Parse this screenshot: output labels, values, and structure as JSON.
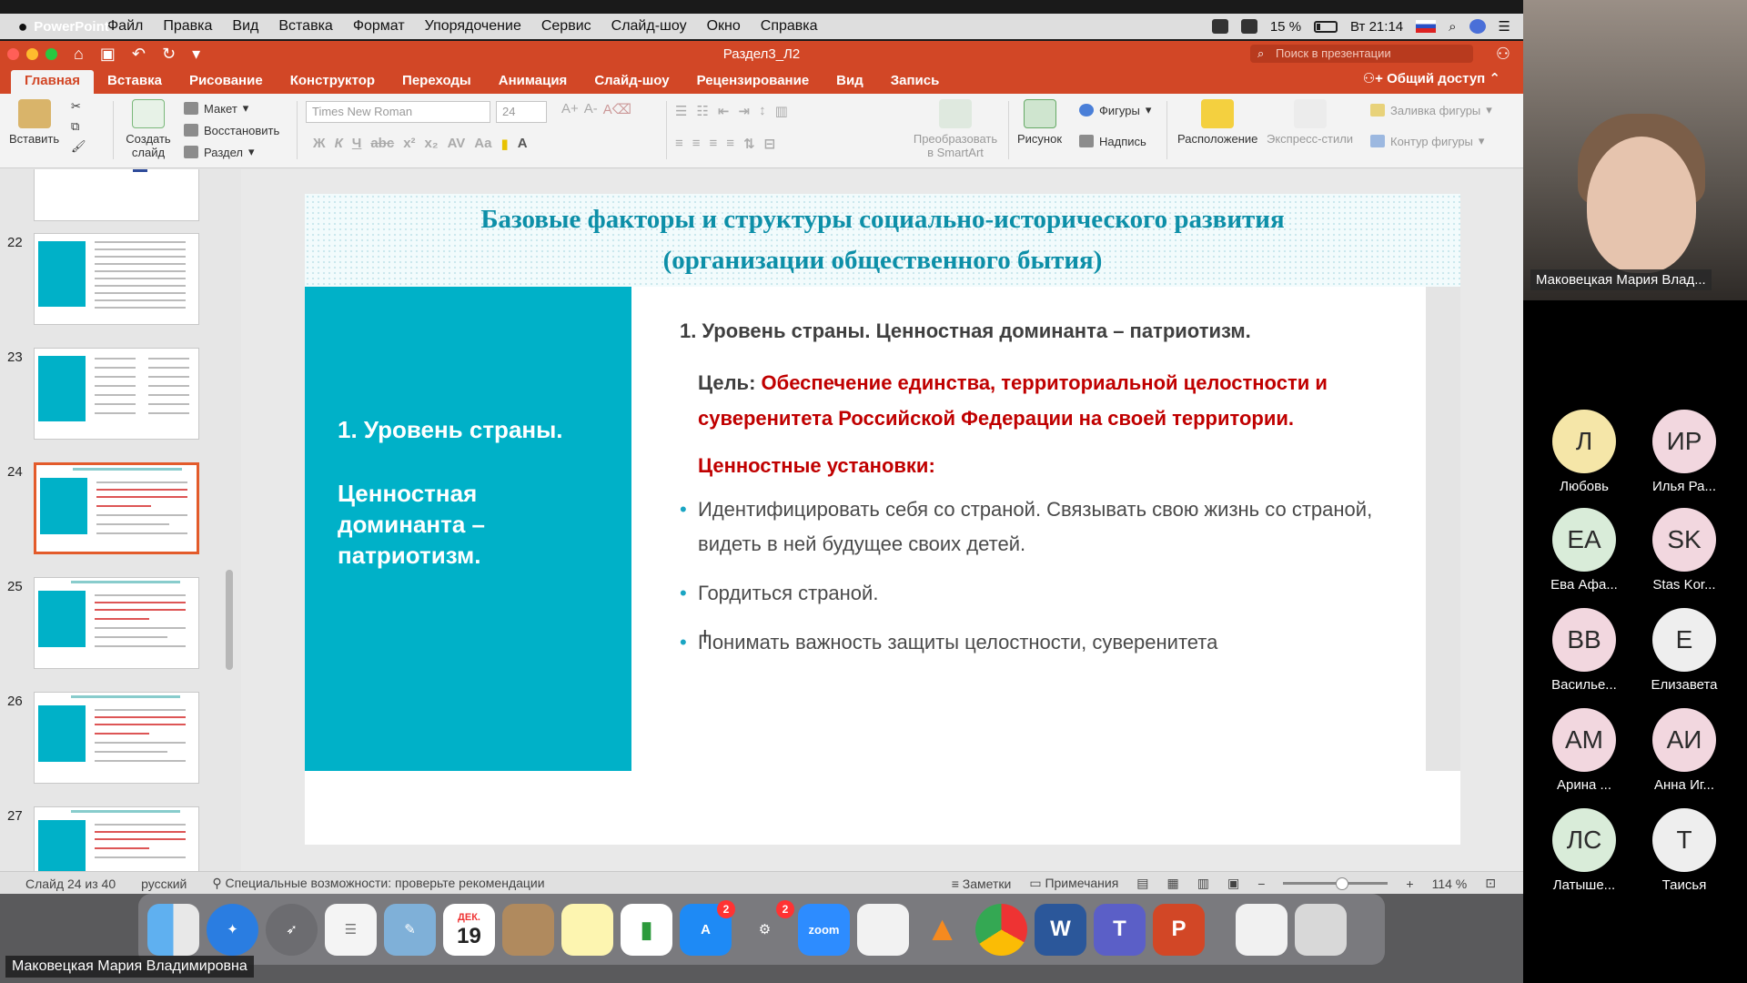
{
  "menubar": {
    "app_name": "PowerPoint",
    "items": [
      "Файл",
      "Правка",
      "Вид",
      "Вставка",
      "Формат",
      "Упорядочение",
      "Сервис",
      "Слайд-шоу",
      "Окно",
      "Справка"
    ],
    "battery": "15 %",
    "clock": "Вт 21:14"
  },
  "window": {
    "doc_title": "Раздел3_Л2",
    "search_placeholder": "Поиск в презентации",
    "share_label": "Общий доступ"
  },
  "ribbon_tabs": [
    "Главная",
    "Вставка",
    "Рисование",
    "Конструктор",
    "Переходы",
    "Анимация",
    "Слайд-шоу",
    "Рецензирование",
    "Вид",
    "Запись"
  ],
  "ribbon": {
    "paste": "Вставить",
    "new_slide": "Создать слайд",
    "layout": "Макет",
    "reset": "Восстановить",
    "section": "Раздел",
    "font_name": "Times New Roman",
    "font_size": "24",
    "convert_smartart": "Преобразовать в SmartArt",
    "picture": "Рисунок",
    "shapes": "Фигуры",
    "textbox": "Надпись",
    "arrange": "Расположение",
    "quick_styles": "Экспресс-стили",
    "shape_fill": "Заливка фигуры",
    "shape_outline": "Контур фигуры"
  },
  "thumbnails": [
    {
      "num": "22"
    },
    {
      "num": "23"
    },
    {
      "num": "24",
      "selected": true
    },
    {
      "num": "25"
    },
    {
      "num": "26"
    },
    {
      "num": "27"
    }
  ],
  "slide": {
    "title_line1": "Базовые факторы и структуры социально-исторического развития",
    "title_line2": "(организации общественного бытия)",
    "left_line1": "1. Уровень страны.",
    "left_line2": "Ценностная доминанта – патриотизм.",
    "level_heading": "1. Уровень страны. Ценностная доминанта – патриотизм.",
    "goal_label": "Цель:",
    "goal_text": "Обеспечение единства, территориальной целостности и суверенитета Российской Федерации на своей территории.",
    "values_heading": "Ценностные установки:",
    "bullets": [
      "Идентифицировать себя со страной. Связывать свою жизнь со страной, видеть в ней будущее своих детей.",
      "Гордиться страной.",
      "Понимать важность защиты целостности, суверенитета"
    ]
  },
  "statusbar": {
    "slide_counter": "Слайд 24 из 40",
    "language": "русский",
    "accessibility": "Специальные возможности: проверьте рекомендации",
    "notes": "Заметки",
    "comments": "Примечания",
    "zoom": "114 %"
  },
  "dock": {
    "calendar_month": "ДЕК.",
    "calendar_day": "19",
    "appstore_badge": "2",
    "settings_badge": "2",
    "zoom_label": "zoom"
  },
  "zoom_meeting": {
    "speaker_video_name": "Маковецкая Мария Влад...",
    "speaker_full_name": "Маковецкая Мария Владимировна",
    "participants": [
      {
        "initials": "Л",
        "name": "Любовь",
        "color": "#f5e6a8"
      },
      {
        "initials": "ИР",
        "name": "Илья Ра...",
        "color": "#f2d7df"
      },
      {
        "initials": "EA",
        "name": "Ева Афа...",
        "color": "#d9ecd9"
      },
      {
        "initials": "SK",
        "name": "Stas Kor...",
        "color": "#f2d7df"
      },
      {
        "initials": "ВВ",
        "name": "Василье...",
        "color": "#f2d7df"
      },
      {
        "initials": "Е",
        "name": "Елизавета",
        "color": "#eeeeee"
      },
      {
        "initials": "АМ",
        "name": "Арина ...",
        "color": "#f2d7df"
      },
      {
        "initials": "АИ",
        "name": "Анна Иг...",
        "color": "#f2d7df"
      },
      {
        "initials": "ЛС",
        "name": "Латыше...",
        "color": "#d9ecd9"
      },
      {
        "initials": "Т",
        "name": "Таисья",
        "color": "#eeeeee"
      }
    ]
  }
}
